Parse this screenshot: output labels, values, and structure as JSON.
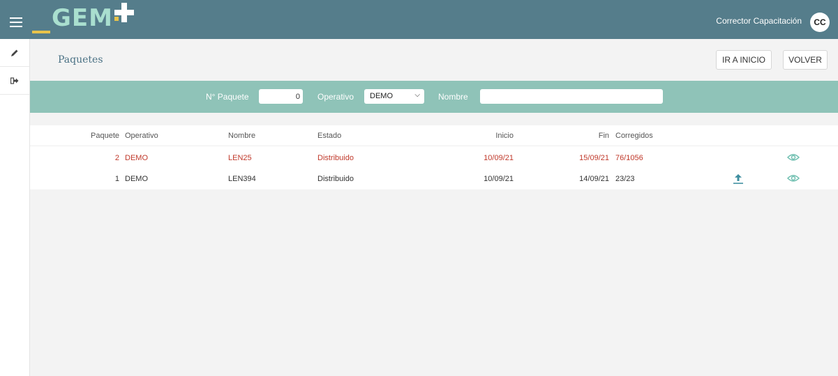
{
  "app": {
    "logo_text": "GEM",
    "user_name": "Corrector Capacitación",
    "user_initials": "CC"
  },
  "page": {
    "title": "Paquetes",
    "buttons": {
      "go_home": "IR A INICIO",
      "back": "VOLVER"
    }
  },
  "filters": {
    "paquete_label": "N° Paquete",
    "paquete_value": "0",
    "operativo_label": "Operativo",
    "operativo_selected": "DEMO",
    "nombre_label": "Nombre",
    "nombre_value": ""
  },
  "table": {
    "columns": [
      "Paquete",
      "Operativo",
      "Nombre",
      "Estado",
      "Inicio",
      "Fin",
      "Corregidos"
    ],
    "rows": [
      {
        "paquete": "2",
        "operativo": "DEMO",
        "nombre": "LEN25",
        "estado": "Distribuido",
        "inicio": "10/09/21",
        "fin": "15/09/21",
        "corregidos": "76/1056",
        "highlight": true
      },
      {
        "paquete": "1",
        "operativo": "DEMO",
        "nombre": "LEN394",
        "estado": "Distribuido",
        "inicio": "10/09/21",
        "fin": "14/09/21",
        "corregidos": "23/23",
        "highlight": false
      }
    ]
  },
  "icons": {
    "menu": "hamburger-icon",
    "edit": "pencil-icon",
    "logout": "sign-out-icon",
    "view": "eye-icon",
    "upload": "upload-icon"
  },
  "colors": {
    "topbar": "#557d8b",
    "filter_band": "#8fc3b8",
    "accent_red": "#c0392b",
    "eye_icon": "#6fbfb0",
    "upload_icon": "#3f8fa0"
  }
}
